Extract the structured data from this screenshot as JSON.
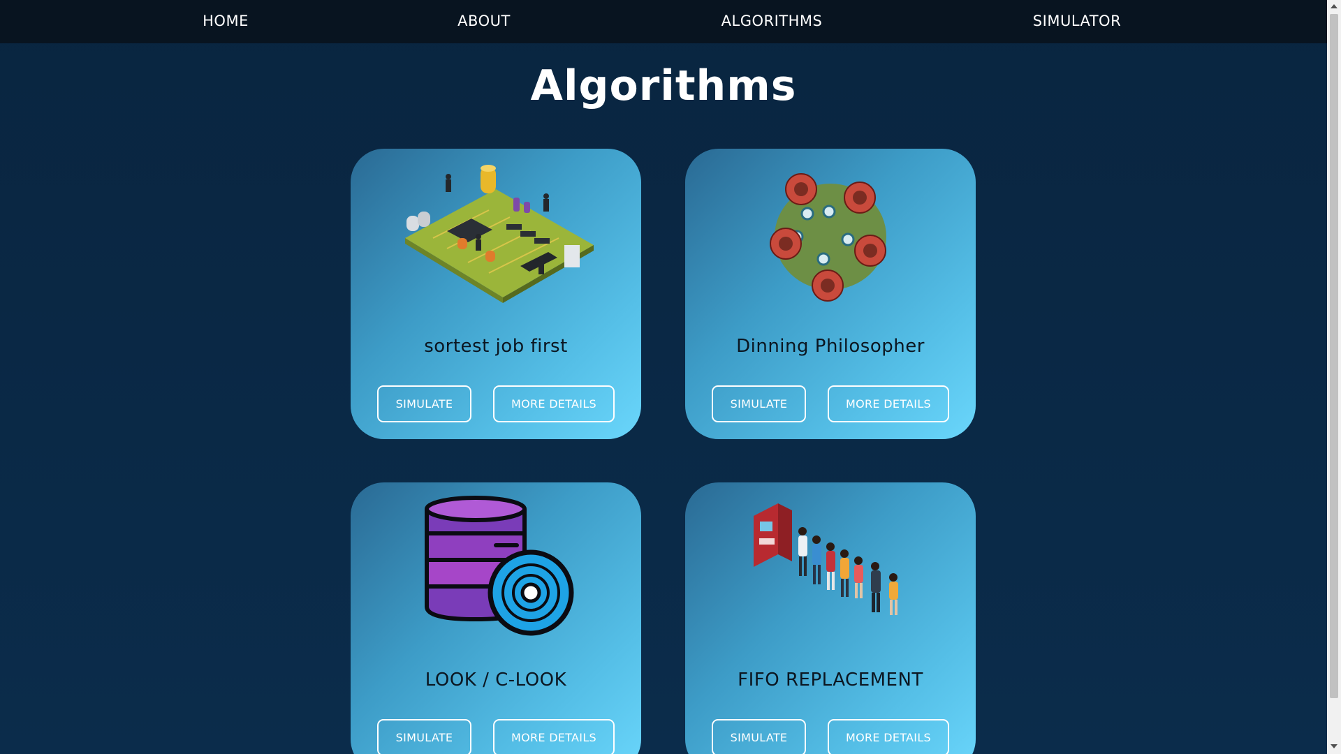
{
  "nav": {
    "items": [
      {
        "label": "HOME"
      },
      {
        "label": "ABOUT"
      },
      {
        "label": "ALGORITHMS"
      },
      {
        "label": "SIMULATOR"
      }
    ]
  },
  "page": {
    "title": "Algorithms"
  },
  "cards": [
    {
      "title": "sortest job first",
      "illustration": "circuit-board-icon",
      "simulate_label": "SIMULATE",
      "details_label": "MORE DETAILS"
    },
    {
      "title": "Dinning Philosopher",
      "illustration": "round-table-icon",
      "simulate_label": "SIMULATE",
      "details_label": "MORE DETAILS"
    },
    {
      "title": "LOOK / C-LOOK",
      "illustration": "database-disk-icon",
      "simulate_label": "SIMULATE",
      "details_label": "MORE DETAILS"
    },
    {
      "title": "FIFO REPLACEMENT",
      "illustration": "atm-queue-icon",
      "simulate_label": "SIMULATE",
      "details_label": "MORE DETAILS"
    }
  ],
  "colors": {
    "background": "#0a2744",
    "navbar": "#081420",
    "card_gradient_start": "#2a6a94",
    "card_gradient_end": "#6ad6fb",
    "card_title": "#0b1621",
    "button_border": "#ffffff"
  }
}
